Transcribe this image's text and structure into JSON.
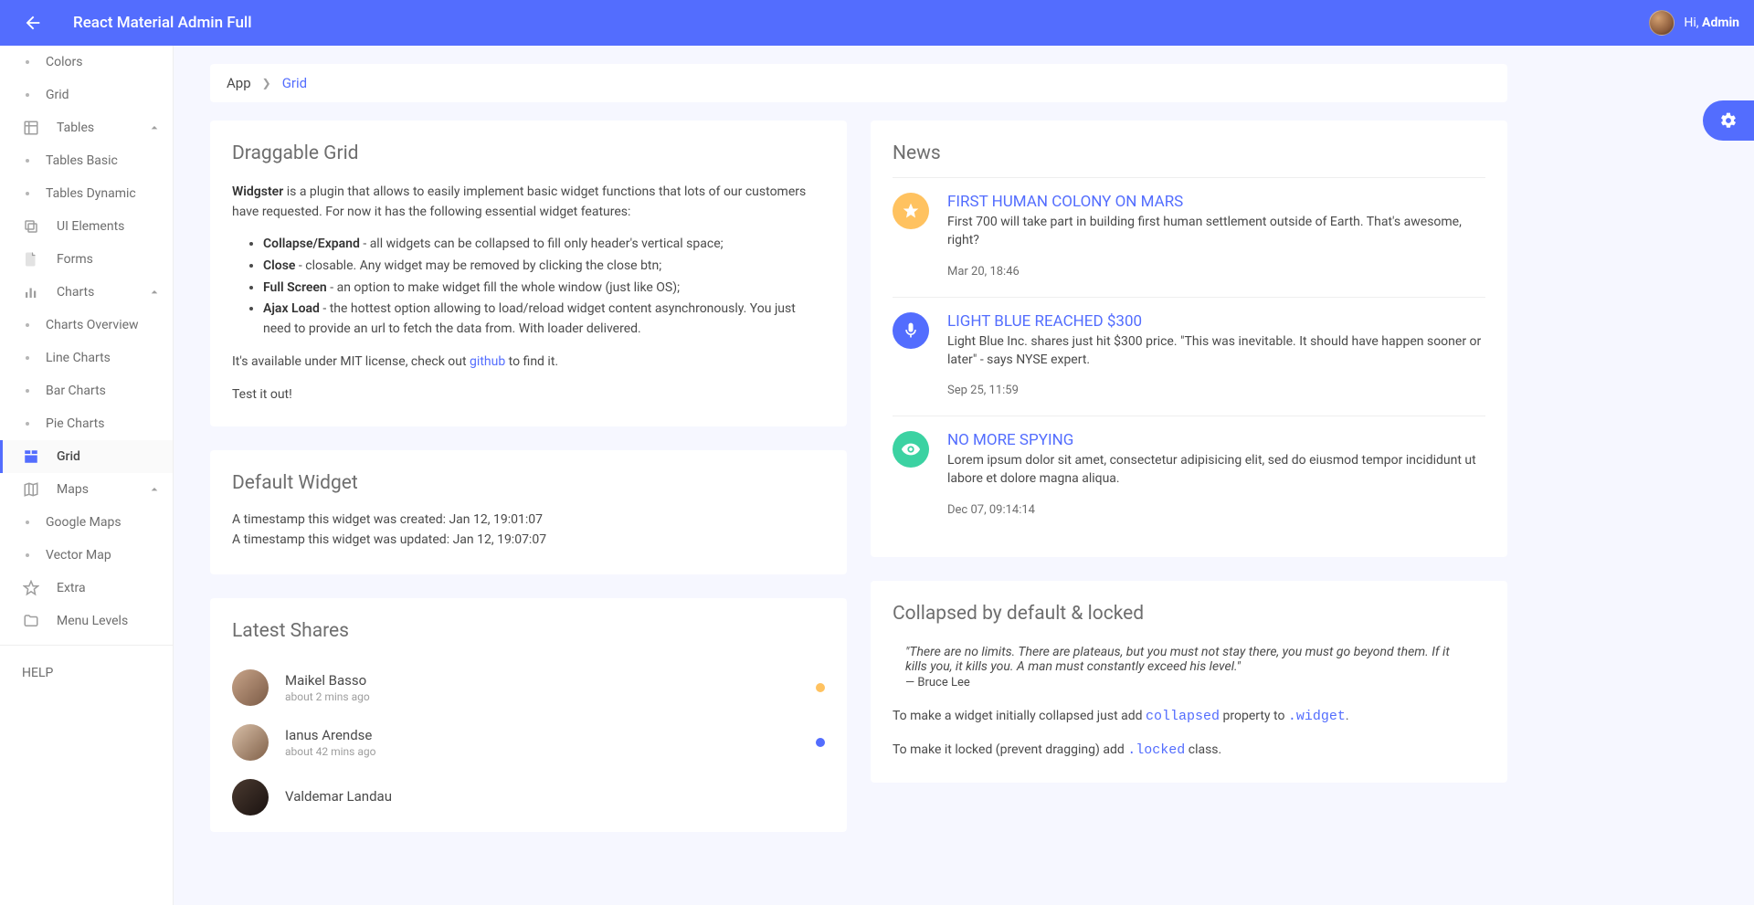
{
  "header": {
    "title": "React Material Admin Full",
    "greeting_prefix": "Hi, ",
    "greeting_name": "Admin"
  },
  "sidebar": {
    "items": [
      {
        "type": "sub-dot",
        "label": "Colors"
      },
      {
        "type": "sub-dot",
        "label": "Grid"
      },
      {
        "type": "icon",
        "icon": "table",
        "label": "Tables",
        "expandable": true
      },
      {
        "type": "sub-dot",
        "label": "Tables Basic"
      },
      {
        "type": "sub-dot",
        "label": "Tables Dynamic"
      },
      {
        "type": "icon",
        "icon": "layers",
        "label": "UI Elements"
      },
      {
        "type": "icon",
        "icon": "file",
        "label": "Forms"
      },
      {
        "type": "icon",
        "icon": "bars",
        "label": "Charts",
        "expandable": true
      },
      {
        "type": "sub-dot",
        "label": "Charts Overview"
      },
      {
        "type": "sub-dot",
        "label": "Line Charts"
      },
      {
        "type": "sub-dot",
        "label": "Bar Charts"
      },
      {
        "type": "sub-dot",
        "label": "Pie Charts"
      },
      {
        "type": "icon",
        "icon": "grid",
        "label": "Grid",
        "active": true
      },
      {
        "type": "icon",
        "icon": "map",
        "label": "Maps",
        "expandable": true
      },
      {
        "type": "sub-dot",
        "label": "Google Maps"
      },
      {
        "type": "sub-dot",
        "label": "Vector Map"
      },
      {
        "type": "icon",
        "icon": "star",
        "label": "Extra"
      },
      {
        "type": "icon",
        "icon": "folder",
        "label": "Menu Levels"
      }
    ],
    "help_label": "HELP"
  },
  "breadcrumb": {
    "root": "App",
    "current": "Grid"
  },
  "draggable": {
    "title": "Draggable Grid",
    "intro_bold": "Widgster",
    "intro_rest": " is a plugin that allows to easily implement basic widget functions that lots of our customers have requested. For now it has the following essential widget features:",
    "features": [
      {
        "b": "Collapse/Expand",
        "rest": " - all widgets can be collapsed to fill only header's vertical space;"
      },
      {
        "b": "Close",
        "rest": " - closable. Any widget may be removed by clicking the close btn;"
      },
      {
        "b": "Full Screen",
        "rest": " - an option to make widget fill the whole window (just like OS);"
      },
      {
        "b": "Ajax Load",
        "rest": " - the hottest option allowing to load/reload widget content asynchronously. You just need to provide an url to fetch the data from. With loader delivered."
      }
    ],
    "license_pre": "It's available under MIT license, check out ",
    "license_link": "github",
    "license_post": " to find it.",
    "test": "Test it out!"
  },
  "default_widget": {
    "title": "Default Widget",
    "created_label": "A timestamp this widget was created: ",
    "created_val": "Jan 12, 19:01:07",
    "updated_label": "A timestamp this widget was updated: ",
    "updated_val": "Jan 12, 19:07:07"
  },
  "shares": {
    "title": "Latest Shares",
    "items": [
      {
        "name": "Maikel Basso",
        "time": "about 2 mins ago",
        "color": "#FFC260",
        "avatarBg": "linear-gradient(135deg,#c9a58a,#7a5a45)"
      },
      {
        "name": "Ianus Arendse",
        "time": "about 42 mins ago",
        "color": "#536DFE",
        "avatarBg": "linear-gradient(135deg,#d8bfa8,#806048)"
      },
      {
        "name": "Valdemar Landau",
        "time": "",
        "color": "",
        "avatarBg": "linear-gradient(135deg,#4a3a30,#1a1210)"
      }
    ]
  },
  "news": {
    "title": "News",
    "items": [
      {
        "icon": "star",
        "title": "FIRST HUMAN COLONY ON MARS",
        "desc": "First 700 will take part in building first human settlement outside of Earth. That's awesome, right?",
        "time": "Mar 20, 18:46"
      },
      {
        "icon": "mic",
        "title": "LIGHT BLUE REACHED $300",
        "desc": "Light Blue Inc. shares just hit $300 price. \"This was inevitable. It should have happen sooner or later\" - says NYSE expert.",
        "time": "Sep 25, 11:59"
      },
      {
        "icon": "eye",
        "title": "NO MORE SPYING",
        "desc": "Lorem ipsum dolor sit amet, consectetur adipisicing elit, sed do eiusmod tempor incididunt ut labore et dolore magna aliqua.",
        "time": "Dec 07, 09:14:14"
      }
    ]
  },
  "collapsed": {
    "title": "Collapsed by default & locked",
    "quote": "\"There are no limits. There are plateaus, but you must not stay there, you must go beyond them. If it kills you, it kills you. A man must constantly exceed his level.\"",
    "quote_src": "— Bruce Lee",
    "p1_pre": "To make a widget initially collapsed just add ",
    "p1_code": "collapsed",
    "p1_mid": " property to ",
    "p1_code2": ".widget",
    "p1_post": ".",
    "p2_pre": "To make it locked (prevent dragging) add ",
    "p2_code": ".locked",
    "p2_post": " class."
  }
}
